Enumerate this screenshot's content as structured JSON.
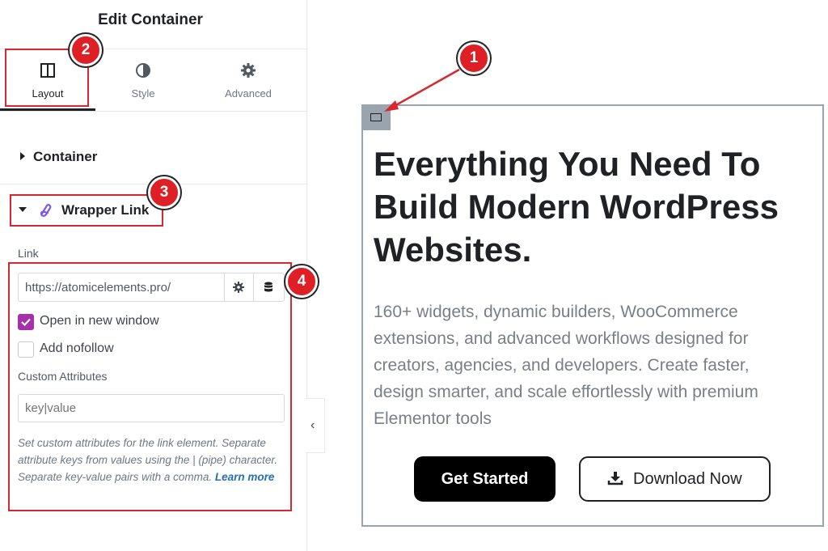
{
  "panel": {
    "title": "Edit Container",
    "tabs": [
      {
        "label": "Layout",
        "icon": "columns-icon",
        "active": true
      },
      {
        "label": "Style",
        "icon": "half-circle-icon",
        "active": false
      },
      {
        "label": "Advanced",
        "icon": "gear-icon",
        "active": false
      }
    ],
    "sections": {
      "container": {
        "label": "Container",
        "expanded": false
      },
      "wrapper_link": {
        "label": "Wrapper Link",
        "expanded": true,
        "icon": "wrapper-link-icon"
      }
    },
    "link": {
      "label": "Link",
      "value": "https://atomicelements.pro/",
      "actions": [
        "gear-icon",
        "database-icon"
      ]
    },
    "checkboxes": [
      {
        "label": "Open in new window",
        "checked": true
      },
      {
        "label": "Add nofollow",
        "checked": false
      }
    ],
    "custom_attributes": {
      "label": "Custom Attributes",
      "placeholder": "key|value",
      "help": "Set custom attributes for the link element. Separate attribute keys from values using the | (pipe) character. Separate key-value pairs with a comma.",
      "help_link": "Learn more"
    }
  },
  "annotations": [
    "1",
    "2",
    "3",
    "4"
  ],
  "hero": {
    "title": "Everything You Need To Build Modern WordPress Websites.",
    "description": "160+ widgets, dynamic builders, WooCommerce extensions, and advanced workflows designed for creators, agencies, and developers. Create faster, design smarter, and scale effortlessly with premium Elementor tools",
    "primary_button": "Get Started",
    "secondary_button": "Download Now",
    "secondary_icon": "download-icon"
  },
  "colors": {
    "annotation_red": "#d7282f",
    "checkbox_accent": "#a530a8",
    "link_blue": "#2271b1"
  }
}
